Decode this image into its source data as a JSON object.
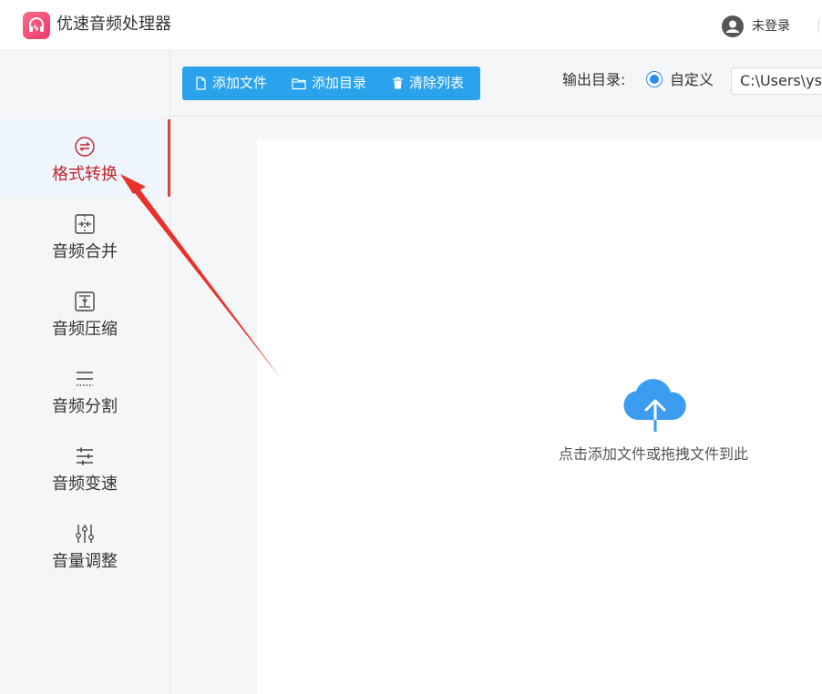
{
  "app": {
    "title": "优速音频处理器",
    "user_label": "未登录"
  },
  "sidebar": {
    "items": [
      {
        "label": "格式转换",
        "icon": "format-convert-icon",
        "active": true
      },
      {
        "label": "音频合并",
        "icon": "merge-icon",
        "active": false
      },
      {
        "label": "音频压缩",
        "icon": "compress-icon",
        "active": false
      },
      {
        "label": "音频分割",
        "icon": "split-icon",
        "active": false
      },
      {
        "label": "音频变速",
        "icon": "speed-sliders-icon",
        "active": false
      },
      {
        "label": "音量调整",
        "icon": "volume-sliders-icon",
        "active": false
      }
    ]
  },
  "toolbar": {
    "add_file": "添加文件",
    "add_dir": "添加目录",
    "clear_list": "清除列表",
    "output_label": "输出目录:",
    "output_option": "自定义",
    "output_path": "C:\\Users\\ys"
  },
  "main": {
    "drop_hint": "点击添加文件或拖拽文件到此"
  },
  "colors": {
    "accent": "#2aa3ec",
    "active_text": "#c0242c",
    "arrow": "#e8322b",
    "cloud": "#3b9cf0"
  }
}
